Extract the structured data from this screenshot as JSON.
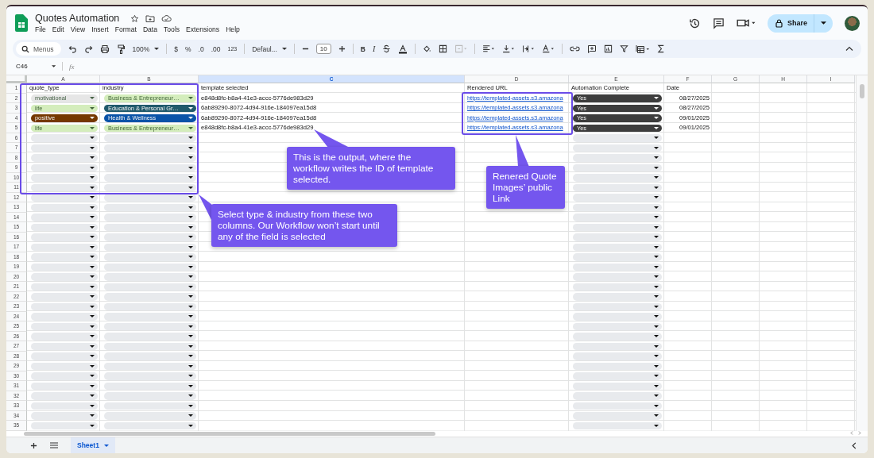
{
  "document": {
    "title": "Quotes Automation"
  },
  "menu": [
    "File",
    "Edit",
    "View",
    "Insert",
    "Format",
    "Data",
    "Tools",
    "Extensions",
    "Help"
  ],
  "share_button": {
    "label": "Share"
  },
  "toolbar": {
    "search_placeholder": "Menus",
    "zoom": "100%",
    "currency": "$",
    "percent": "%",
    "decrease_decimals": ".0",
    "increase_decimals": ".00",
    "number_format": "123",
    "font": "Defaul...",
    "font_size": "10",
    "bold": "B",
    "italic": "I"
  },
  "formula_bar": {
    "cell": "C46",
    "fx": "fx"
  },
  "columns": [
    {
      "letter": "A",
      "selected": false
    },
    {
      "letter": "B",
      "selected": false
    },
    {
      "letter": "C",
      "selected": true
    },
    {
      "letter": "D",
      "selected": false
    },
    {
      "letter": "E",
      "selected": false
    },
    {
      "letter": "F",
      "selected": false
    },
    {
      "letter": "G",
      "selected": false
    },
    {
      "letter": "H",
      "selected": false
    },
    {
      "letter": "I",
      "selected": false
    }
  ],
  "rows": [
    {
      "number": "1",
      "a": {
        "kind": "text",
        "text": "quote_type"
      },
      "b": {
        "kind": "text",
        "text": "industry"
      },
      "c": {
        "kind": "text",
        "text": "template selected"
      },
      "d": {
        "kind": "text",
        "text": "Rendered URL"
      },
      "e": {
        "kind": "text",
        "text": "Automation Complete"
      },
      "f": {
        "kind": "text",
        "text": "Date"
      }
    },
    {
      "number": "2",
      "a": {
        "kind": "dropdown",
        "text": "motivational",
        "color": "#e6e6e6"
      },
      "b": {
        "kind": "dropdown",
        "text": "Business & Entrepreneur…",
        "color": "#d4edbc"
      },
      "c": {
        "kind": "text",
        "text": "e848d8fc-b8a4-41e3-accc-5776de983d29"
      },
      "d": {
        "kind": "link",
        "text": "https://templated-assets.s3.amazona"
      },
      "e": {
        "kind": "dropdown",
        "text": "Yes",
        "color": "#3d3d3d"
      },
      "f": {
        "kind": "date",
        "text": "08/27/2025"
      }
    },
    {
      "number": "3",
      "a": {
        "kind": "dropdown",
        "text": "life",
        "color": "#d4edbc"
      },
      "b": {
        "kind": "dropdown",
        "text": "Education & Personal Gr…",
        "color": "#215a6c"
      },
      "c": {
        "kind": "text",
        "text": "6ab89290-8072-4d94-916e-184097ea15d8"
      },
      "d": {
        "kind": "link",
        "text": "https://templated-assets.s3.amazona"
      },
      "e": {
        "kind": "dropdown",
        "text": "Yes",
        "color": "#3d3d3d"
      },
      "f": {
        "kind": "date",
        "text": "08/27/2025"
      }
    },
    {
      "number": "4",
      "a": {
        "kind": "dropdown",
        "text": "positive",
        "color": "#753800"
      },
      "b": {
        "kind": "dropdown",
        "text": "Health & Wellness",
        "color": "#0a53a8"
      },
      "c": {
        "kind": "text",
        "text": "6ab89290-8072-4d94-916e-184097ea15d8"
      },
      "d": {
        "kind": "link",
        "text": "https://templated-assets.s3.amazona"
      },
      "e": {
        "kind": "dropdown",
        "text": "Yes",
        "color": "#3d3d3d"
      },
      "f": {
        "kind": "date",
        "text": "09/01/2025"
      }
    },
    {
      "number": "5",
      "a": {
        "kind": "dropdown",
        "text": "life",
        "color": "#d4edbc"
      },
      "b": {
        "kind": "dropdown",
        "text": "Business & Entrepreneur…",
        "color": "#d4edbc"
      },
      "c": {
        "kind": "text",
        "text": "e848d8fc-b8a4-41e3-accc-5776de983d29"
      },
      "d": {
        "kind": "link",
        "text": "https://templated-assets.s3.amazona"
      },
      "e": {
        "kind": "dropdown",
        "text": "Yes",
        "color": "#3d3d3d"
      },
      "f": {
        "kind": "date",
        "text": "09/01/2025"
      }
    },
    {
      "number": "6",
      "a": {
        "kind": "dropdown"
      },
      "b": {
        "kind": "dropdown"
      },
      "e": {
        "kind": "dropdown"
      }
    },
    {
      "number": "7",
      "a": {
        "kind": "dropdown"
      },
      "b": {
        "kind": "dropdown"
      },
      "e": {
        "kind": "dropdown"
      }
    },
    {
      "number": "8",
      "a": {
        "kind": "dropdown"
      },
      "b": {
        "kind": "dropdown"
      },
      "e": {
        "kind": "dropdown"
      }
    },
    {
      "number": "9",
      "a": {
        "kind": "dropdown"
      },
      "b": {
        "kind": "dropdown"
      },
      "e": {
        "kind": "dropdown"
      }
    },
    {
      "number": "10",
      "a": {
        "kind": "dropdown"
      },
      "b": {
        "kind": "dropdown"
      },
      "e": {
        "kind": "dropdown"
      }
    },
    {
      "number": "11",
      "a": {
        "kind": "dropdown"
      },
      "b": {
        "kind": "dropdown"
      },
      "e": {
        "kind": "dropdown"
      }
    },
    {
      "number": "12",
      "a": {
        "kind": "dropdown"
      },
      "b": {
        "kind": "dropdown"
      },
      "e": {
        "kind": "dropdown"
      }
    },
    {
      "number": "13",
      "a": {
        "kind": "dropdown"
      },
      "b": {
        "kind": "dropdown"
      },
      "e": {
        "kind": "dropdown"
      }
    },
    {
      "number": "14",
      "a": {
        "kind": "dropdown"
      },
      "b": {
        "kind": "dropdown"
      },
      "e": {
        "kind": "dropdown"
      }
    },
    {
      "number": "15",
      "a": {
        "kind": "dropdown"
      },
      "b": {
        "kind": "dropdown"
      },
      "e": {
        "kind": "dropdown"
      }
    },
    {
      "number": "16",
      "a": {
        "kind": "dropdown"
      },
      "b": {
        "kind": "dropdown"
      },
      "e": {
        "kind": "dropdown"
      }
    },
    {
      "number": "17",
      "a": {
        "kind": "dropdown"
      },
      "b": {
        "kind": "dropdown"
      },
      "e": {
        "kind": "dropdown"
      }
    },
    {
      "number": "18",
      "a": {
        "kind": "dropdown"
      },
      "b": {
        "kind": "dropdown"
      },
      "e": {
        "kind": "dropdown"
      }
    },
    {
      "number": "19",
      "a": {
        "kind": "dropdown"
      },
      "b": {
        "kind": "dropdown"
      },
      "e": {
        "kind": "dropdown"
      }
    },
    {
      "number": "20",
      "a": {
        "kind": "dropdown"
      },
      "b": {
        "kind": "dropdown"
      },
      "e": {
        "kind": "dropdown"
      }
    },
    {
      "number": "21",
      "a": {
        "kind": "dropdown"
      },
      "b": {
        "kind": "dropdown"
      },
      "e": {
        "kind": "dropdown"
      }
    },
    {
      "number": "22",
      "a": {
        "kind": "dropdown"
      },
      "b": {
        "kind": "dropdown"
      },
      "e": {
        "kind": "dropdown"
      }
    },
    {
      "number": "23",
      "a": {
        "kind": "dropdown"
      },
      "b": {
        "kind": "dropdown"
      },
      "e": {
        "kind": "dropdown"
      }
    },
    {
      "number": "24",
      "a": {
        "kind": "dropdown"
      },
      "b": {
        "kind": "dropdown"
      },
      "e": {
        "kind": "dropdown"
      }
    },
    {
      "number": "25",
      "a": {
        "kind": "dropdown"
      },
      "b": {
        "kind": "dropdown"
      },
      "e": {
        "kind": "dropdown"
      }
    },
    {
      "number": "26",
      "a": {
        "kind": "dropdown"
      },
      "b": {
        "kind": "dropdown"
      },
      "e": {
        "kind": "dropdown"
      }
    },
    {
      "number": "27",
      "a": {
        "kind": "dropdown"
      },
      "b": {
        "kind": "dropdown"
      },
      "e": {
        "kind": "dropdown"
      }
    },
    {
      "number": "28",
      "a": {
        "kind": "dropdown"
      },
      "b": {
        "kind": "dropdown"
      },
      "e": {
        "kind": "dropdown"
      }
    },
    {
      "number": "29",
      "a": {
        "kind": "dropdown"
      },
      "b": {
        "kind": "dropdown"
      },
      "e": {
        "kind": "dropdown"
      }
    },
    {
      "number": "30",
      "a": {
        "kind": "dropdown"
      },
      "b": {
        "kind": "dropdown"
      },
      "e": {
        "kind": "dropdown"
      }
    },
    {
      "number": "31",
      "a": {
        "kind": "dropdown"
      },
      "b": {
        "kind": "dropdown"
      },
      "e": {
        "kind": "dropdown"
      }
    },
    {
      "number": "32",
      "a": {
        "kind": "dropdown"
      },
      "b": {
        "kind": "dropdown"
      },
      "e": {
        "kind": "dropdown"
      }
    },
    {
      "number": "33",
      "a": {
        "kind": "dropdown"
      },
      "b": {
        "kind": "dropdown"
      },
      "e": {
        "kind": "dropdown"
      }
    },
    {
      "number": "34",
      "a": {
        "kind": "dropdown"
      },
      "b": {
        "kind": "dropdown"
      },
      "e": {
        "kind": "dropdown"
      }
    },
    {
      "number": "35",
      "a": {
        "kind": "dropdown"
      },
      "b": {
        "kind": "dropdown"
      },
      "e": {
        "kind": "dropdown"
      }
    }
  ],
  "callouts": [
    "This is the output, where the workflow writes the ID of template selected.",
    "Select type & industry from these two columns. Our Workflow won’t start until any of the field is selected",
    "Renered Quote Images’ public Link"
  ],
  "sheet_tabs": [
    {
      "label": "Sheet1",
      "selected": true
    }
  ]
}
